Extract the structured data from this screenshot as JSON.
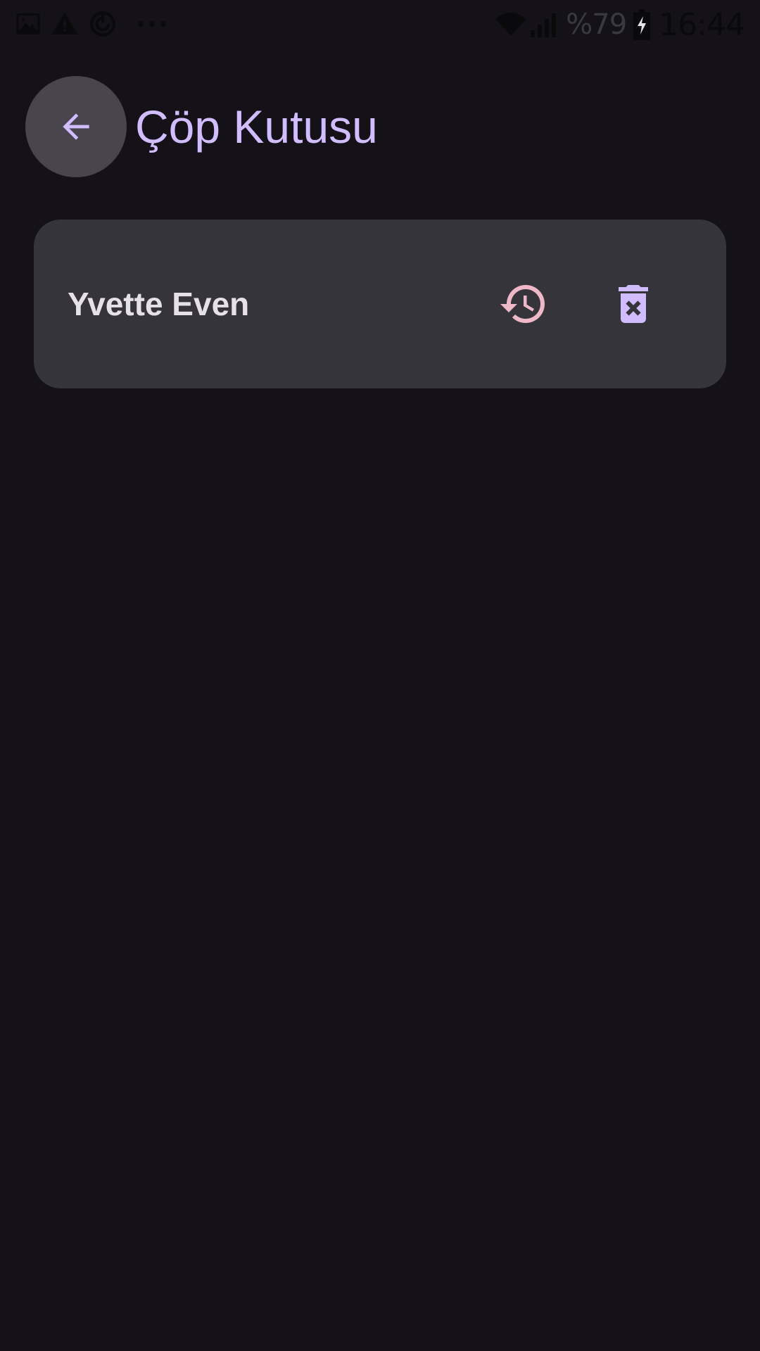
{
  "status_bar": {
    "icons_left": [
      "image-icon",
      "warning-icon",
      "sync-icon",
      "more-dots-icon"
    ],
    "icons_right": [
      "wifi-icon",
      "signal-icon",
      "battery-charging-icon"
    ],
    "battery_percent": "%79",
    "time": "16:44"
  },
  "app_bar": {
    "back_icon": "arrow-back-icon",
    "title": "Çöp Kutusu"
  },
  "trash_items": [
    {
      "name": "Yvette Even",
      "restore_icon": "restore-history-icon",
      "delete_icon": "delete-forever-icon"
    }
  ],
  "colors": {
    "background": "#141218",
    "card": "#36343b",
    "back_button_bg": "#49454f",
    "title": "#d0bcff",
    "restore_icon": "#efb8c8",
    "delete_icon": "#d0bcff",
    "item_text": "#e6e0e9"
  }
}
